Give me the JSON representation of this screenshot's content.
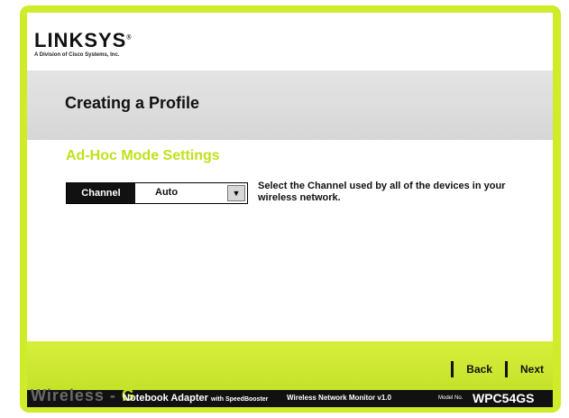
{
  "header": {
    "logo": "LINKSYS",
    "logo_mark": "®",
    "logo_subtitle": "A Division of Cisco Systems, Inc.",
    "page_title": "Creating a Profile"
  },
  "section": {
    "title": "Ad-Hoc Mode Settings",
    "channel_label": "Channel",
    "channel_value": "Auto",
    "help_text": "Select the Channel used by all of the devices in your wireless network."
  },
  "nav": {
    "back_label": "Back",
    "next_label": "Next"
  },
  "footer": {
    "brand_main": "Wireless",
    "brand_dash": "-",
    "brand_g": "G",
    "product": "Notebook Adapter",
    "product_suffix": "with SpeedBooster",
    "monitor": "Wireless Network Monitor v1.0",
    "model_no_label": "Model No.",
    "model": "WPC54GS"
  },
  "colors": {
    "accent": "#c2e01a",
    "band": "#d6d6d6",
    "footer": "#111111"
  }
}
